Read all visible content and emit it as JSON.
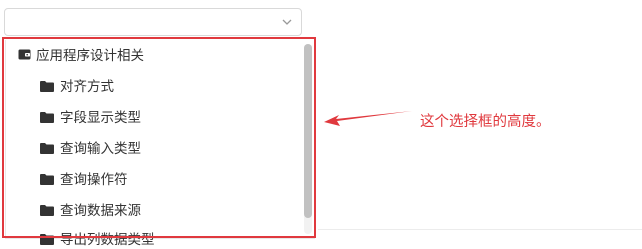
{
  "select": {
    "value": ""
  },
  "tree": {
    "root": {
      "label": "应用程序设计相关",
      "icon": "wallet-icon"
    },
    "children": [
      {
        "label": "对齐方式",
        "icon": "folder-icon"
      },
      {
        "label": "字段显示类型",
        "icon": "folder-icon"
      },
      {
        "label": "查询输入类型",
        "icon": "folder-icon"
      },
      {
        "label": "查询操作符",
        "icon": "folder-icon"
      },
      {
        "label": "查询数据来源",
        "icon": "folder-icon"
      },
      {
        "label": "导出列数据类型",
        "icon": "folder-icon"
      }
    ]
  },
  "annotation": {
    "text": "这个选择框的高度。",
    "color": "#e0393e"
  }
}
